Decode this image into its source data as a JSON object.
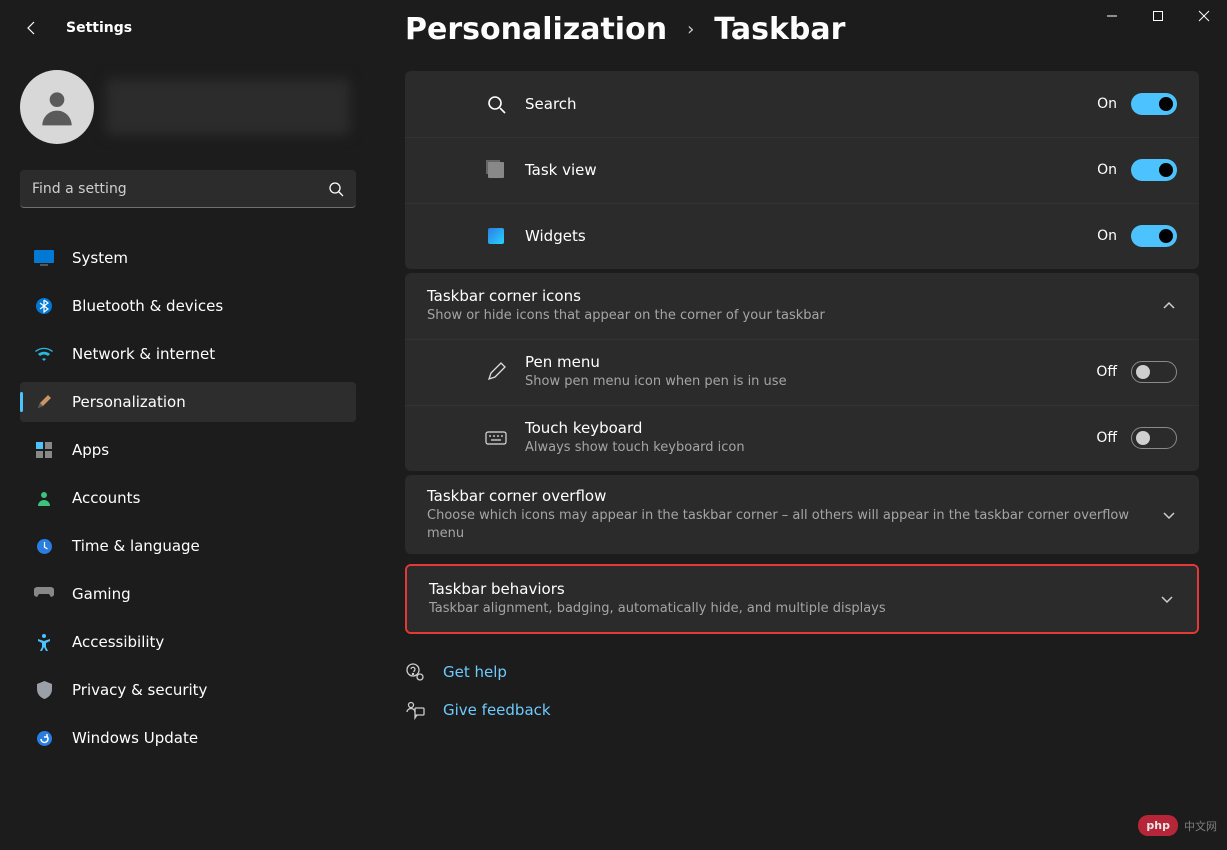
{
  "app": {
    "title": "Settings"
  },
  "search": {
    "placeholder": "Find a setting"
  },
  "sidebar": {
    "items": [
      {
        "label": "System"
      },
      {
        "label": "Bluetooth & devices"
      },
      {
        "label": "Network & internet"
      },
      {
        "label": "Personalization"
      },
      {
        "label": "Apps"
      },
      {
        "label": "Accounts"
      },
      {
        "label": "Time & language"
      },
      {
        "label": "Gaming"
      },
      {
        "label": "Accessibility"
      },
      {
        "label": "Privacy & security"
      },
      {
        "label": "Windows Update"
      }
    ]
  },
  "breadcrumb": {
    "parent": "Personalization",
    "current": "Taskbar"
  },
  "toggles": {
    "on": "On",
    "off": "Off"
  },
  "taskbarItems": [
    {
      "label": "Search",
      "state": "On"
    },
    {
      "label": "Task view",
      "state": "On"
    },
    {
      "label": "Widgets",
      "state": "On"
    }
  ],
  "sections": {
    "cornerIcons": {
      "title": "Taskbar corner icons",
      "sub": "Show or hide icons that appear on the corner of your taskbar",
      "items": [
        {
          "label": "Pen menu",
          "sub": "Show pen menu icon when pen is in use",
          "state": "Off"
        },
        {
          "label": "Touch keyboard",
          "sub": "Always show touch keyboard icon",
          "state": "Off"
        }
      ]
    },
    "overflow": {
      "title": "Taskbar corner overflow",
      "sub": "Choose which icons may appear in the taskbar corner – all others will appear in the taskbar corner overflow menu"
    },
    "behaviors": {
      "title": "Taskbar behaviors",
      "sub": "Taskbar alignment, badging, automatically hide, and multiple displays"
    }
  },
  "links": {
    "help": "Get help",
    "feedback": "Give feedback"
  },
  "watermark": {
    "badge": "php",
    "text": "中文网"
  }
}
